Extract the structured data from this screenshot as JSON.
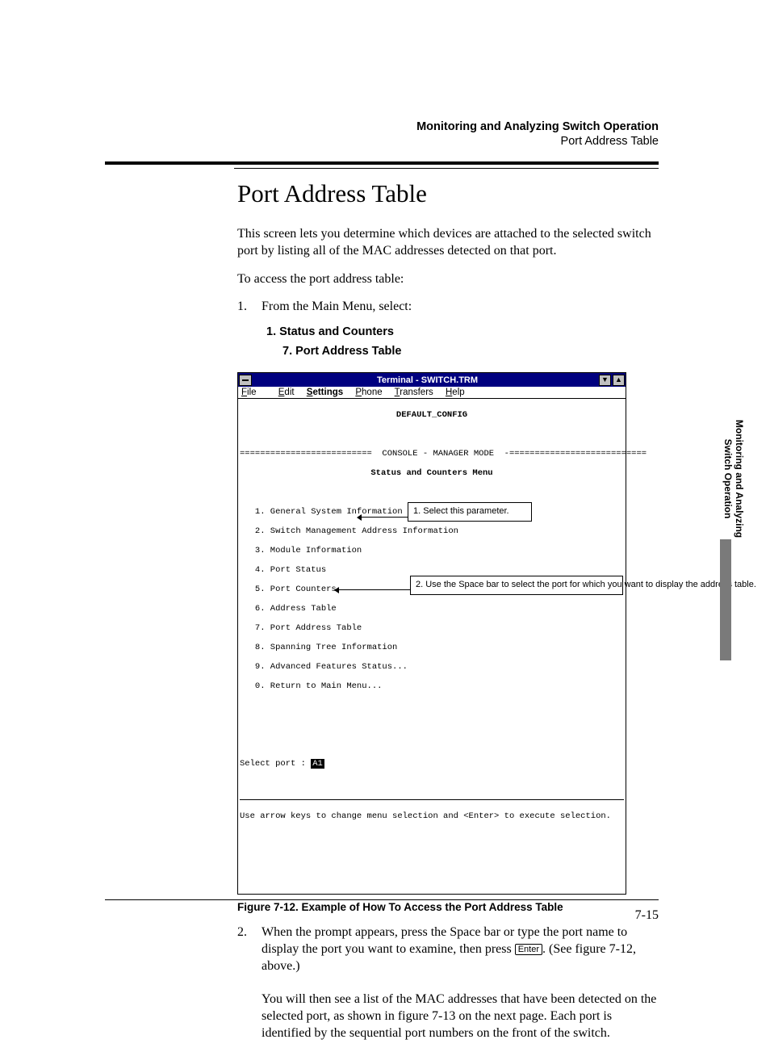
{
  "header": {
    "line1": "Monitoring and Analyzing Switch Operation",
    "line2": "Port Address Table"
  },
  "title": "Port Address Table",
  "intro": "This screen lets you determine which devices are attached to the selected switch port by listing all of the MAC addresses detected on that port.",
  "lead": "To access the port address table:",
  "step1": {
    "num": "1.",
    "text": "From the Main Menu, select:"
  },
  "menu1": "1. Status and Counters",
  "menu2": "7. Port Address Table",
  "terminal": {
    "title": "Terminal - SWITCH.TRM",
    "sysmenu_char": "—",
    "down": "▼",
    "up": "▲",
    "menubar": {
      "file": "File",
      "edit": "Edit",
      "settings": "Settings",
      "phone": "Phone",
      "transfers": "Transfers",
      "help": "Help"
    },
    "defaultcfg": "DEFAULT_CONFIG",
    "mode_line": "==========================  CONSOLE - MANAGER MODE  -===========================",
    "menuTitle": "Status and Counters Menu",
    "items": [
      "1. General System Information",
      "2. Switch Management Address Information",
      "3. Module Information",
      "4. Port Status",
      "5. Port Counters",
      "6. Address Table",
      "7. Port Address Table",
      "8. Spanning Tree Information",
      "9. Advanced Features Status...",
      "0. Return to Main Menu..."
    ],
    "selectPortLabel": "Select port : ",
    "selectPortValue": "A1",
    "hint": "Use arrow keys to change menu selection and <Enter> to execute selection.",
    "callout1": "1. Select this parameter.",
    "callout2": "2. Use the Space bar to select the port for which you want to display the address table."
  },
  "figcap": "Figure 7-12.  Example of How To Access the Port Address Table",
  "step2": {
    "num": "2.",
    "textA": "When the   prompt appears, press the Space bar or type the port name to display the port you want to examine, then press ",
    "key": "Enter",
    "textB": ". (See figure 7-12, above.)"
  },
  "para3": "You will then see a list of the MAC addresses that have been detected on the selected port, as shown in figure 7-13 on the next page. Each port is identified by the sequential port numbers on the front of the switch.",
  "pagenum": "7-15",
  "sidetab": {
    "l1": "Monitoring and Analyzing",
    "l2": "Switch Operation"
  }
}
